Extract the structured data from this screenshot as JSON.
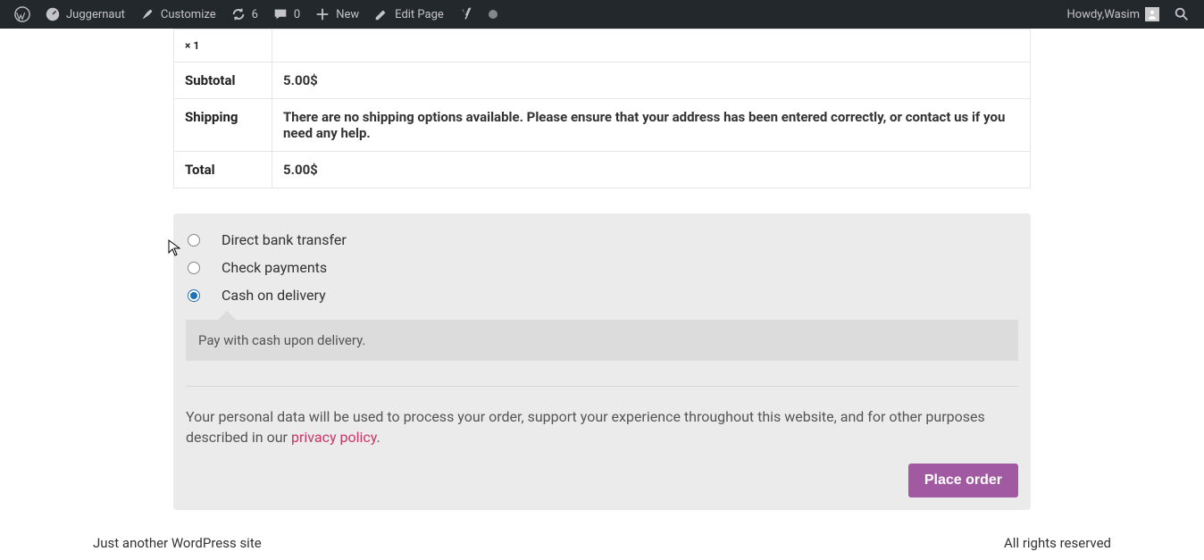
{
  "adminbar": {
    "site_name": "Juggernaut",
    "customize": "Customize",
    "updates_count": "6",
    "comments_count": "0",
    "new_label": "New",
    "edit_label": "Edit Page",
    "howdy_prefix": "Howdy, ",
    "username": "Wasim"
  },
  "order_table": {
    "qty_row": "× 1",
    "subtotal_label": "Subtotal",
    "subtotal_value": "5.00$",
    "shipping_label": "Shipping",
    "shipping_value": "There are no shipping options available. Please ensure that your address has been entered correctly, or contact us if you need any help.",
    "total_label": "Total",
    "total_value": "5.00$"
  },
  "payment": {
    "methods": [
      {
        "label": "Direct bank transfer",
        "checked": false
      },
      {
        "label": "Check payments",
        "checked": false
      },
      {
        "label": "Cash on delivery",
        "checked": true
      }
    ],
    "description": "Pay with cash upon delivery."
  },
  "privacy": {
    "text_before": "Your personal data will be used to process your order, support your experience throughout this website, and for other purposes described in our ",
    "link_text": "privacy policy",
    "text_after": "."
  },
  "actions": {
    "place_order": "Place order"
  },
  "footer": {
    "tagline": "Just another WordPress site",
    "rights": "All rights reserved"
  }
}
